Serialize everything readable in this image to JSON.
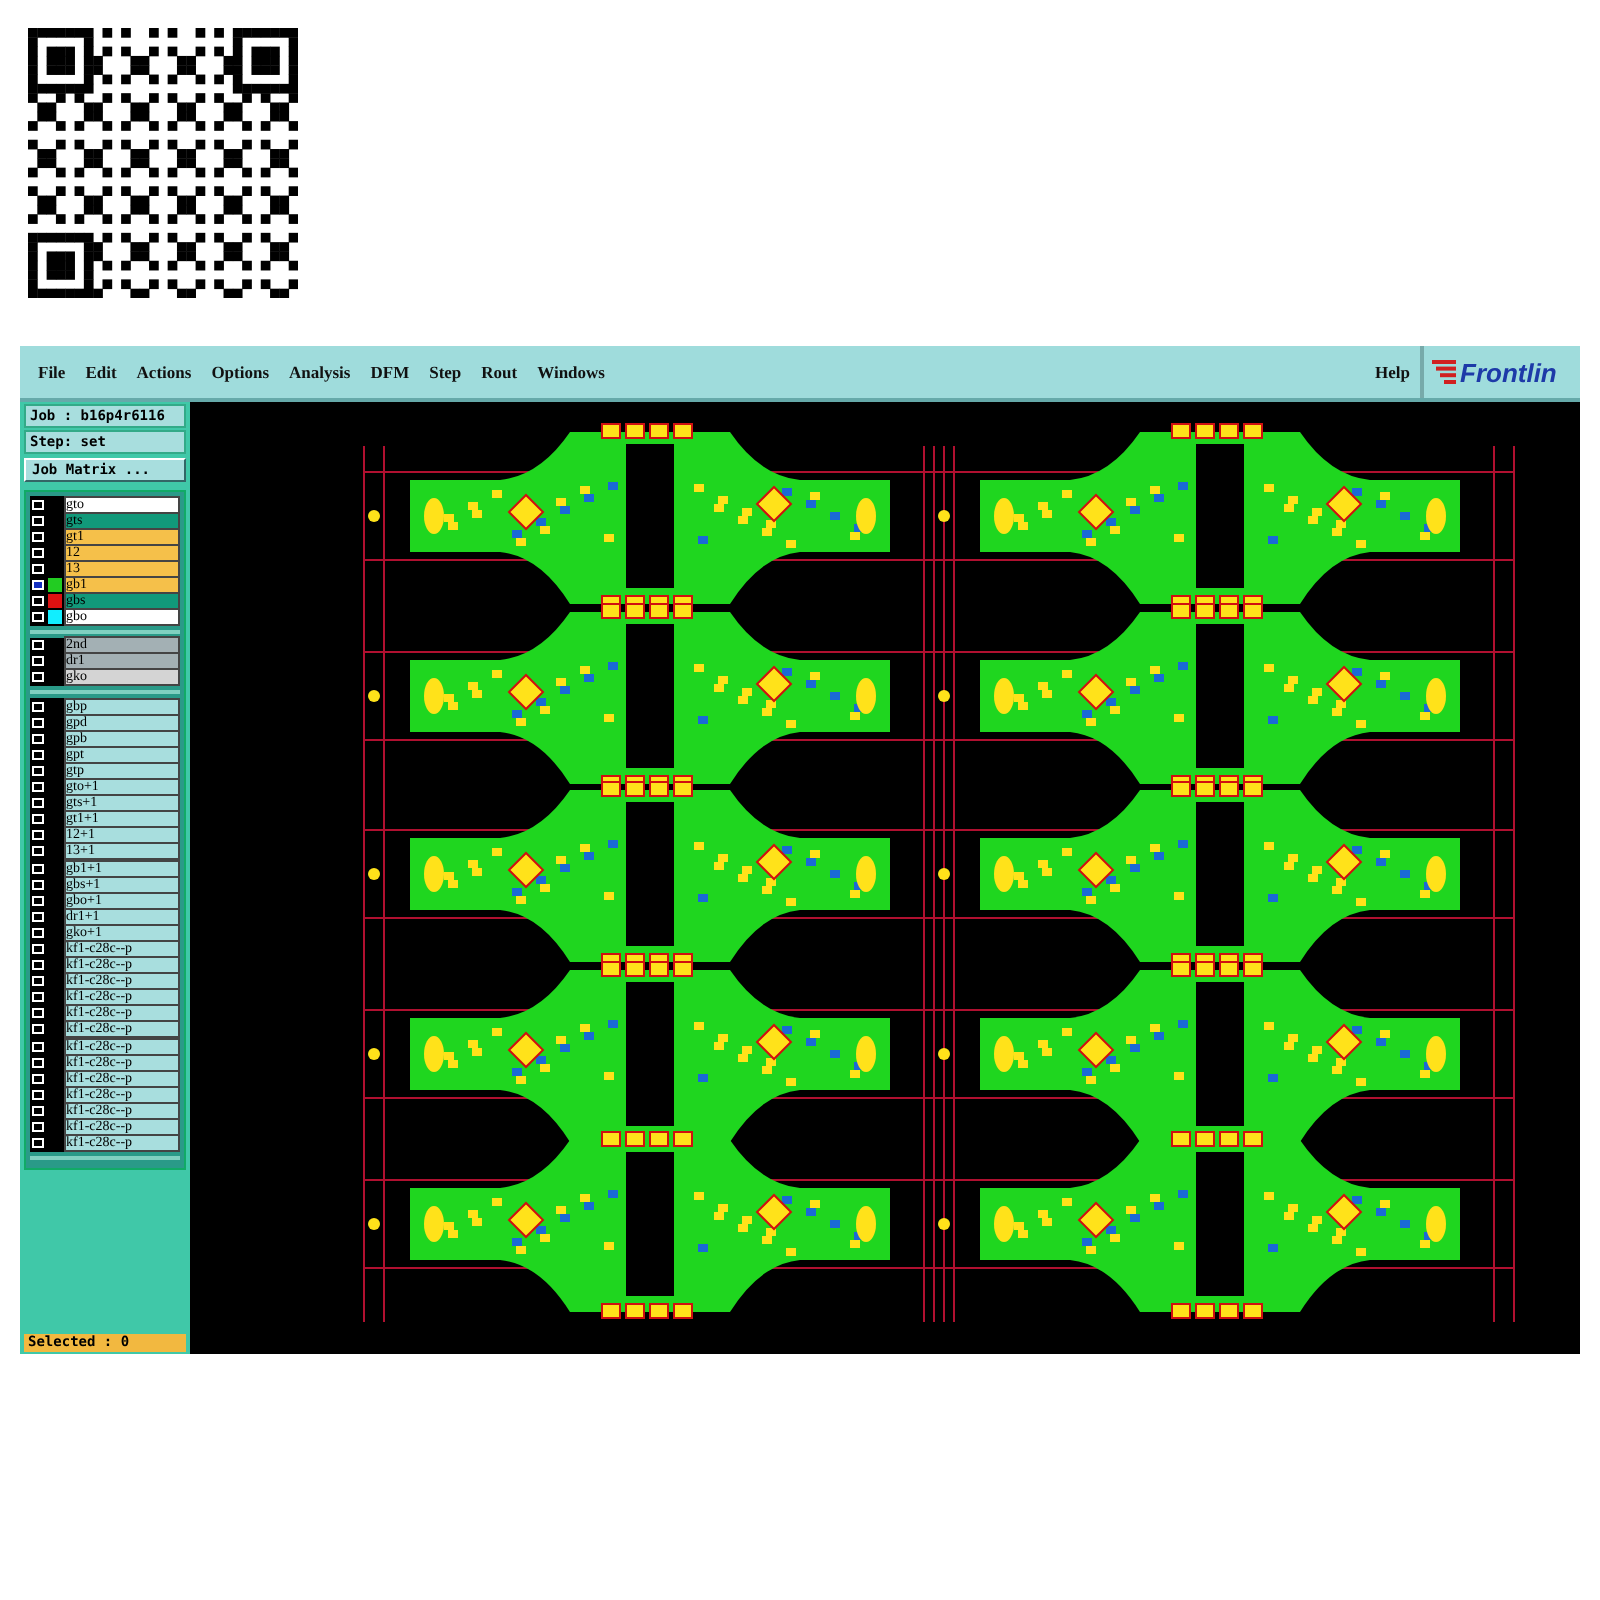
{
  "menu_bar": {
    "items": [
      "File",
      "Edit",
      "Actions",
      "Options",
      "Analysis",
      "DFM",
      "Step",
      "Rout",
      "Windows"
    ],
    "help": "Help",
    "logo": "Frontlin"
  },
  "job_panel": {
    "job": "Job : b16p4r6116",
    "step": "Step: set",
    "matrix_button": "Job Matrix ..."
  },
  "layer_groups": [
    {
      "layers": [
        {
          "name": "gto",
          "selected": false,
          "color": "#ffffff"
        },
        {
          "name": "gts",
          "selected": false,
          "color": "#11997a"
        },
        {
          "name": "gt1",
          "selected": false,
          "color": "#f5c04a"
        },
        {
          "name": "12",
          "selected": false,
          "color": "#f5c04a"
        },
        {
          "name": "13",
          "selected": false,
          "color": "#f5c04a"
        },
        {
          "name": "gb1",
          "selected": true,
          "color": "#f5c04a",
          "swatch": {
            "color": "#22cc22"
          }
        },
        {
          "name": "gbs",
          "selected": false,
          "color": "#11997a",
          "swatch": {
            "color": "#dd1111"
          }
        },
        {
          "name": "gbo",
          "selected": false,
          "color": "#ffffff",
          "swatch": {
            "color": "#11eeff"
          }
        }
      ]
    },
    {
      "layers": [
        {
          "name": "2nd",
          "selected": false,
          "color": "#a3b0b4"
        },
        {
          "name": "dr1",
          "selected": false,
          "color": "#a3b0b4"
        },
        {
          "name": "gko",
          "selected": false,
          "color": "#d4d4d4"
        }
      ]
    },
    {
      "layers": [
        {
          "name": "gbp",
          "selected": false,
          "color": "#a8dede"
        },
        {
          "name": "gpd",
          "selected": false,
          "color": "#a8dede"
        },
        {
          "name": "gpb",
          "selected": false,
          "color": "#a8dede"
        },
        {
          "name": "gpt",
          "selected": false,
          "color": "#a8dede"
        },
        {
          "name": "gtp",
          "selected": false,
          "color": "#a8dede"
        },
        {
          "name": "gto+1",
          "selected": false,
          "color": "#a8dede"
        },
        {
          "name": "gts+1",
          "selected": false,
          "color": "#a8dede"
        },
        {
          "name": "gt1+1",
          "selected": false,
          "color": "#a8dede"
        },
        {
          "name": "12+1",
          "selected": false,
          "color": "#a8dede"
        },
        {
          "name": "13+1",
          "selected": false,
          "color": "#a8dede"
        },
        {
          "name": "gb1+1",
          "selected": false,
          "color": "#a8dede"
        },
        {
          "name": "gbs+1",
          "selected": false,
          "color": "#a8dede"
        },
        {
          "name": "gbo+1",
          "selected": false,
          "color": "#a8dede"
        },
        {
          "name": "dr1+1",
          "selected": false,
          "color": "#a8dede"
        },
        {
          "name": "gko+1",
          "selected": false,
          "color": "#a8dede"
        },
        {
          "name": "kf1-c28c--p",
          "selected": false,
          "color": "#a8dede"
        },
        {
          "name": "kf1-c28c--p",
          "selected": false,
          "color": "#a8dede"
        },
        {
          "name": "kf1-c28c--p",
          "selected": false,
          "color": "#a8dede"
        },
        {
          "name": "kf1-c28c--p",
          "selected": false,
          "color": "#a8dede"
        },
        {
          "name": "kf1-c28c--p",
          "selected": false,
          "color": "#a8dede"
        },
        {
          "name": "kf1-c28c--p",
          "selected": false,
          "color": "#a8dede"
        },
        {
          "name": "kf1-c28c--p",
          "selected": false,
          "color": "#a8dede"
        },
        {
          "name": "kf1-c28c--p",
          "selected": false,
          "color": "#a8dede"
        },
        {
          "name": "kf1-c28c--p",
          "selected": false,
          "color": "#a8dede"
        },
        {
          "name": "kf1-c28c--p",
          "selected": false,
          "color": "#a8dede"
        },
        {
          "name": "kf1-c28c--p",
          "selected": false,
          "color": "#a8dede"
        },
        {
          "name": "kf1-c28c--p",
          "selected": false,
          "color": "#a8dede"
        },
        {
          "name": "kf1-c28c--p",
          "selected": false,
          "color": "#a8dede"
        }
      ]
    }
  ],
  "status_bar": {
    "text": "Selected : 0"
  }
}
